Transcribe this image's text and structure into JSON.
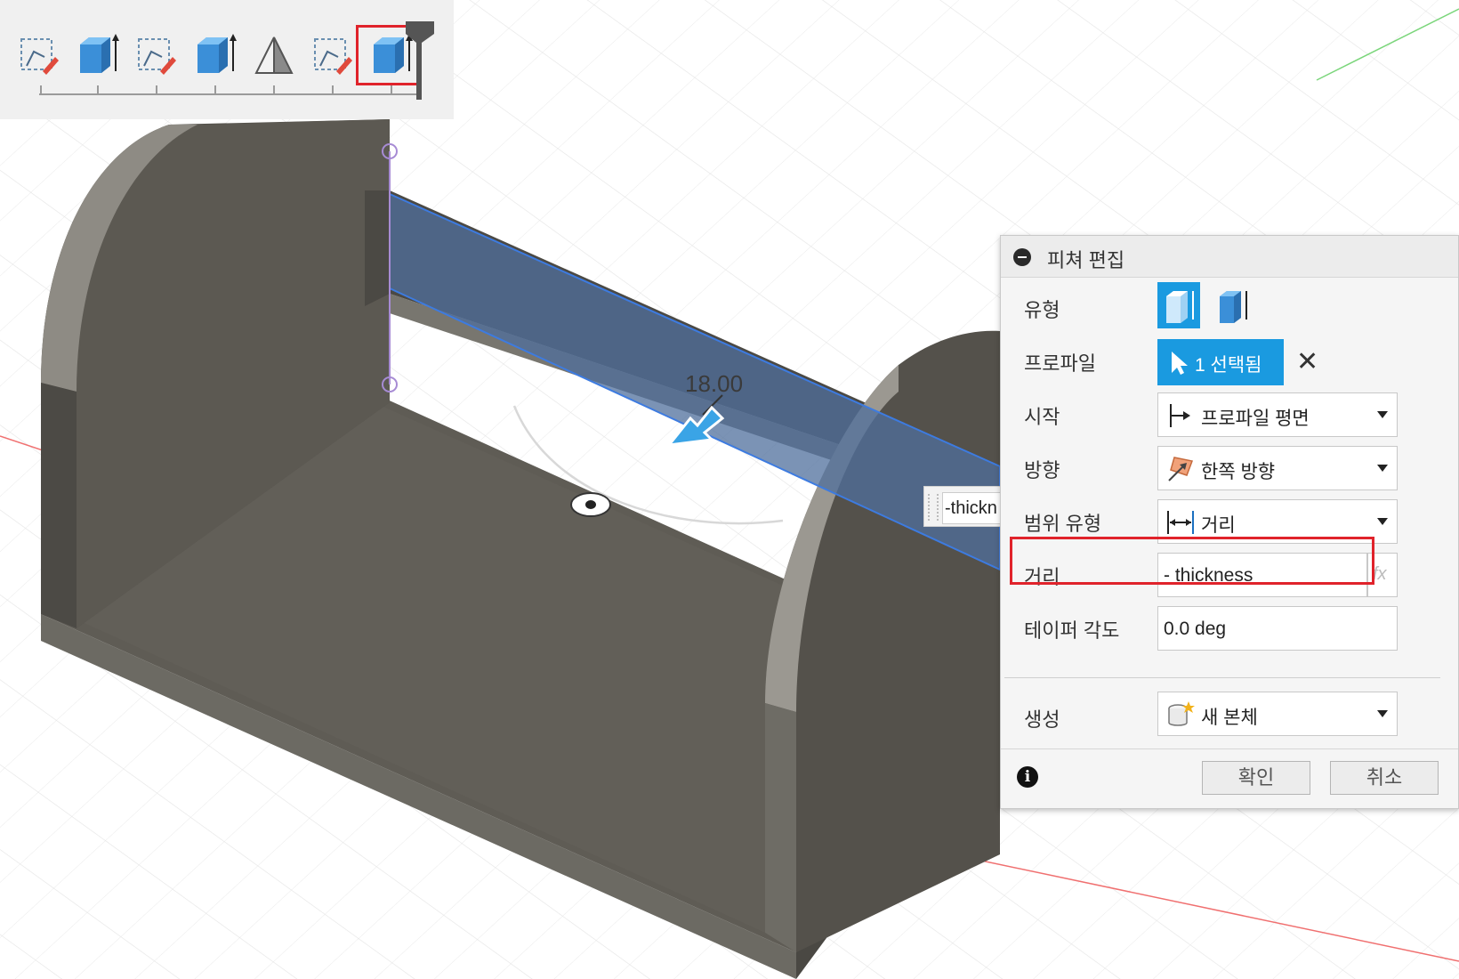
{
  "viewport": {
    "dimension_value": "18.00",
    "inline_input_value": "-thickn"
  },
  "timeline": {
    "items": [
      "sketch-icon",
      "extrude-icon",
      "sketch-icon",
      "extrude-icon",
      "plane-icon",
      "sketch-icon",
      "extrude-icon"
    ]
  },
  "panel": {
    "title": "피쳐 편집",
    "type_label": "유형",
    "profile_label": "프로파일",
    "profile_button": "1 선택됨",
    "start_label": "시작",
    "start_value": "프로파일 평면",
    "direction_label": "방향",
    "direction_value": "한쪽 방향",
    "extent_label": "범위 유형",
    "extent_value": "거리",
    "distance_label": "거리",
    "distance_value": "- thickness",
    "fx": "fx",
    "taper_label": "테이퍼 각도",
    "taper_value": "0.0 deg",
    "operation_label": "생성",
    "operation_value": "새 본체",
    "ok": "확인",
    "cancel": "취소"
  },
  "colors": {
    "accent": "#1a9ae0",
    "highlight": "#e0232b",
    "body": "#5a5750"
  }
}
